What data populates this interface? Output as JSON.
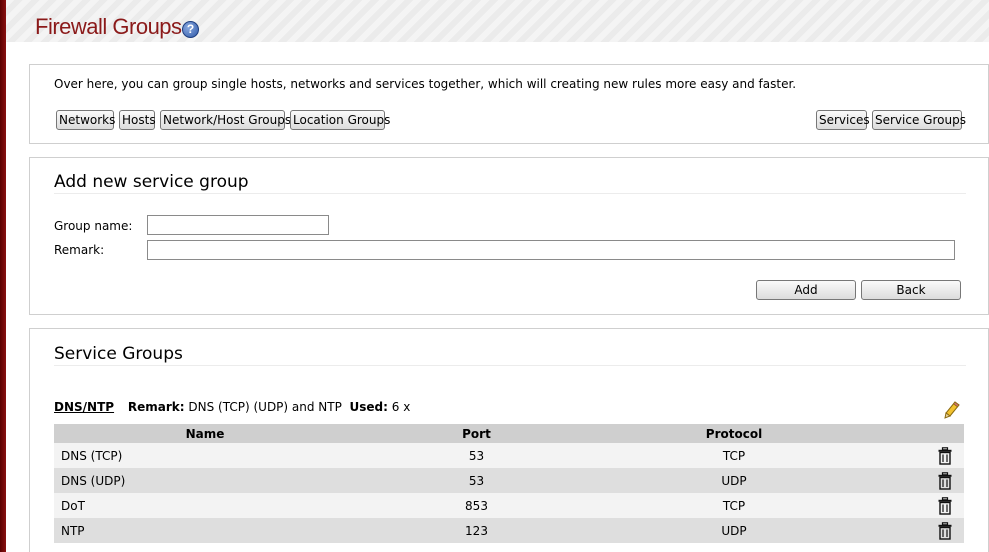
{
  "page": {
    "title": "Firewall Groups",
    "help_glyph": "?"
  },
  "intro": {
    "text": "Over here, you can group single hosts, networks and services together, which will creating new rules more easy and faster.",
    "nav_buttons": [
      "Networks",
      "Hosts",
      "Network/Host Groups",
      "Location Groups",
      "Services",
      "Service Groups"
    ]
  },
  "add_form": {
    "title": "Add new service group",
    "group_name_label": "Group name:",
    "group_name_value": "",
    "remark_label": "Remark:",
    "remark_value": "",
    "add_label": "Add",
    "back_label": "Back"
  },
  "service_groups": {
    "title": "Service Groups",
    "group": {
      "name": "DNS/NTP",
      "remark_label": "Remark:",
      "remark": "DNS (TCP) (UDP) and NTP",
      "used_label": "Used:",
      "used": "6 x"
    },
    "columns": [
      "Name",
      "Port",
      "Protocol"
    ],
    "rows": [
      {
        "name": "DNS (TCP)",
        "port": "53",
        "protocol": "TCP"
      },
      {
        "name": "DNS (UDP)",
        "port": "53",
        "protocol": "UDP"
      },
      {
        "name": "DoT",
        "port": "853",
        "protocol": "TCP"
      },
      {
        "name": "NTP",
        "port": "123",
        "protocol": "UDP"
      }
    ]
  },
  "icons": {
    "help": "help-icon",
    "edit": "pencil-icon",
    "delete": "trash-icon"
  },
  "colors": {
    "title": "#8b1a1a",
    "left_bar": "#8a1010",
    "table_header": "#cfcfcf",
    "row_light": "#f3f3f3",
    "row_dark": "#dedede"
  }
}
